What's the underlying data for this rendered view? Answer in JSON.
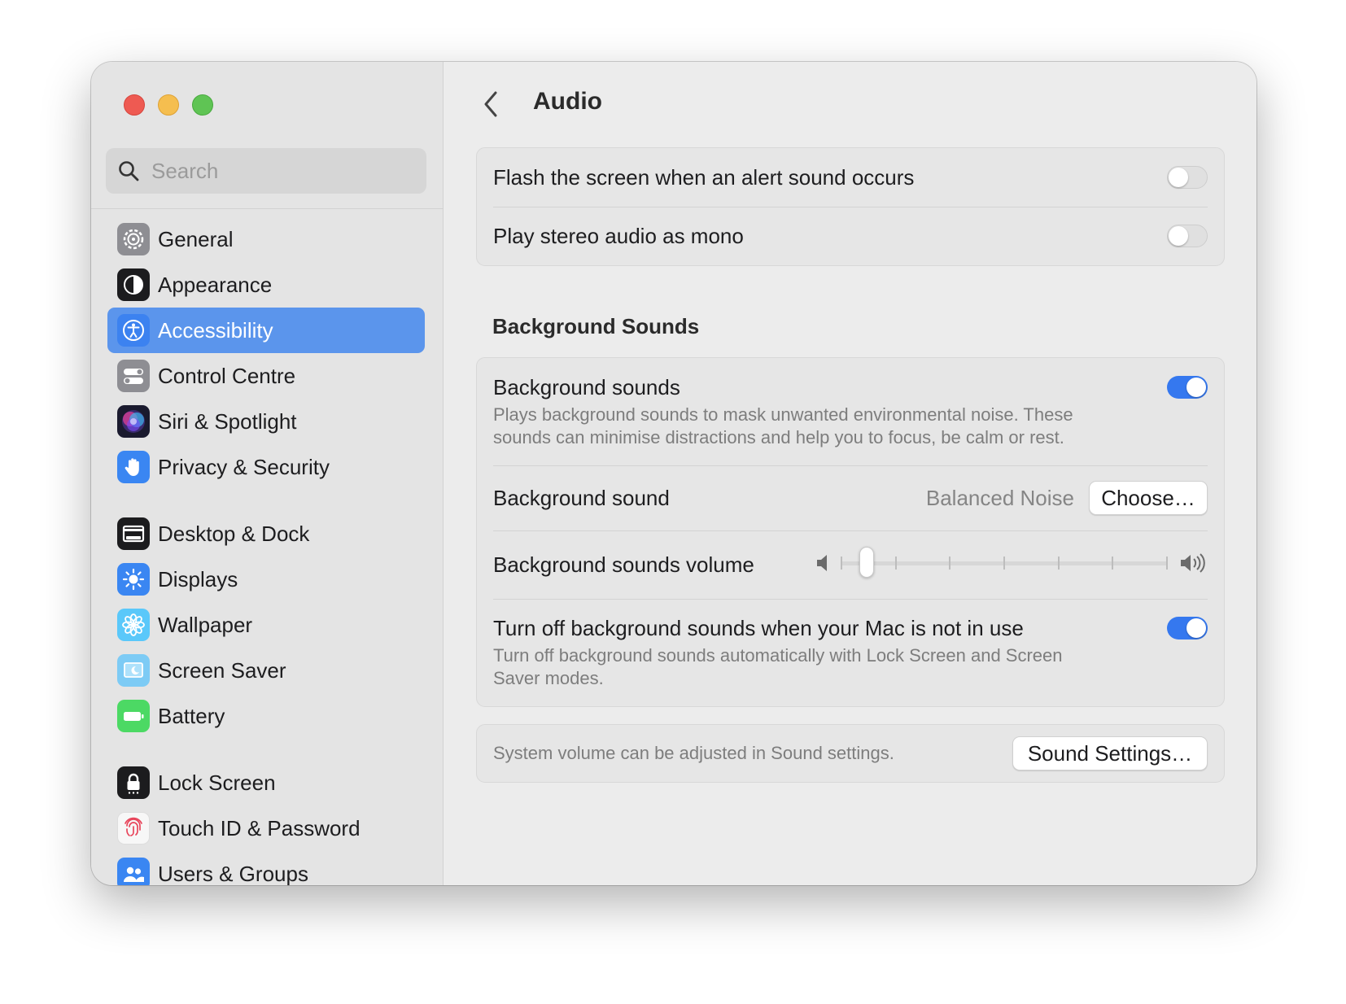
{
  "sidebar": {
    "search_placeholder": "Search",
    "items": [
      {
        "label": "General",
        "icon": "gear-icon"
      },
      {
        "label": "Appearance",
        "icon": "appearance-icon"
      },
      {
        "label": "Accessibility",
        "icon": "accessibility-icon",
        "selected": true
      },
      {
        "label": "Control Centre",
        "icon": "control-centre-icon"
      },
      {
        "label": "Siri & Spotlight",
        "icon": "siri-icon"
      },
      {
        "label": "Privacy & Security",
        "icon": "hand-icon"
      },
      {
        "label": "Desktop & Dock",
        "icon": "dock-icon"
      },
      {
        "label": "Displays",
        "icon": "sun-icon"
      },
      {
        "label": "Wallpaper",
        "icon": "flower-icon"
      },
      {
        "label": "Screen Saver",
        "icon": "screen-saver-icon"
      },
      {
        "label": "Battery",
        "icon": "battery-icon"
      },
      {
        "label": "Lock Screen",
        "icon": "lock-icon"
      },
      {
        "label": "Touch ID & Password",
        "icon": "fingerprint-icon"
      },
      {
        "label": "Users & Groups",
        "icon": "users-icon"
      }
    ]
  },
  "main": {
    "title": "Audio",
    "alerts": {
      "flash_label": "Flash the screen when an alert sound occurs",
      "flash_on": false,
      "mono_label": "Play stereo audio as mono",
      "mono_on": false
    },
    "background_section_title": "Background Sounds",
    "background": {
      "enable_label": "Background sounds",
      "enable_desc_1": "Plays background sounds to mask unwanted environmental noise. These",
      "enable_desc_2": "sounds can minimise distractions and help you to focus, be calm or rest.",
      "enable_on": true,
      "sound_label": "Background sound",
      "sound_value": "Balanced Noise",
      "choose_label": "Choose…",
      "volume_label": "Background sounds volume",
      "volume_level": 0.06,
      "turnoff_label": "Turn off background sounds when your Mac is not in use",
      "turnoff_desc_1": "Turn off background sounds automatically with Lock Screen and Screen",
      "turnoff_desc_2": "Saver modes.",
      "turnoff_on": true
    },
    "system_volume_note": "System volume can be adjusted in Sound settings.",
    "sound_settings_label": "Sound Settings…",
    "help_label": "?"
  },
  "colors": {
    "accent": "#3578ef",
    "sidebar_selection": "#5b95ec"
  }
}
